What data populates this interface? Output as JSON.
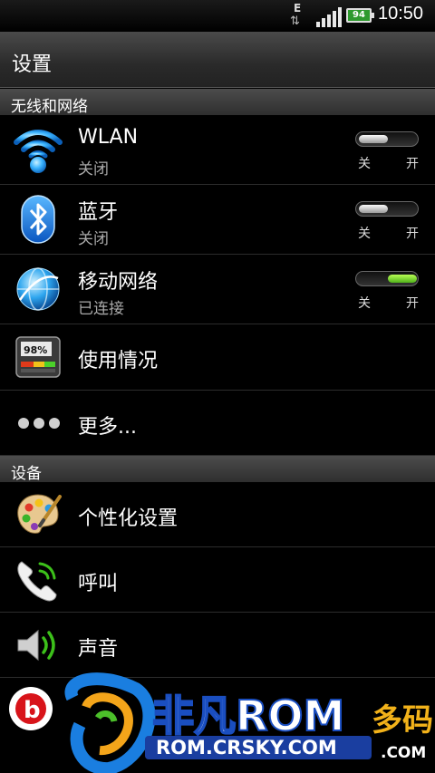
{
  "status_bar": {
    "network_type": "E",
    "battery_level": "94",
    "time": "10:50"
  },
  "app": {
    "title": "设置"
  },
  "sections": {
    "wireless": "无线和网络",
    "device": "设备"
  },
  "items": {
    "wlan": {
      "label": "WLAN",
      "status": "关闭",
      "off": "关",
      "on": "开",
      "enabled": false
    },
    "bluetooth": {
      "label": "蓝牙",
      "status": "关闭",
      "off": "关",
      "on": "开",
      "enabled": false
    },
    "mobile": {
      "label": "移动网络",
      "status": "已连接",
      "off": "关",
      "on": "开",
      "enabled": true
    },
    "usage": {
      "label": "使用情况",
      "icon_text": "98%"
    },
    "more": {
      "label": "更多..."
    },
    "personalize": {
      "label": "个性化设置"
    },
    "call": {
      "label": "呼叫"
    },
    "sound": {
      "label": "声音"
    }
  },
  "watermark": {
    "brand": "非凡ROM",
    "url": "ROM.CRSKY.COM",
    "right_text": "多码",
    "right_sub": ".COM"
  },
  "colors": {
    "accent_green": "#6fd62a",
    "wifi_blue": "#2aa8ff"
  }
}
